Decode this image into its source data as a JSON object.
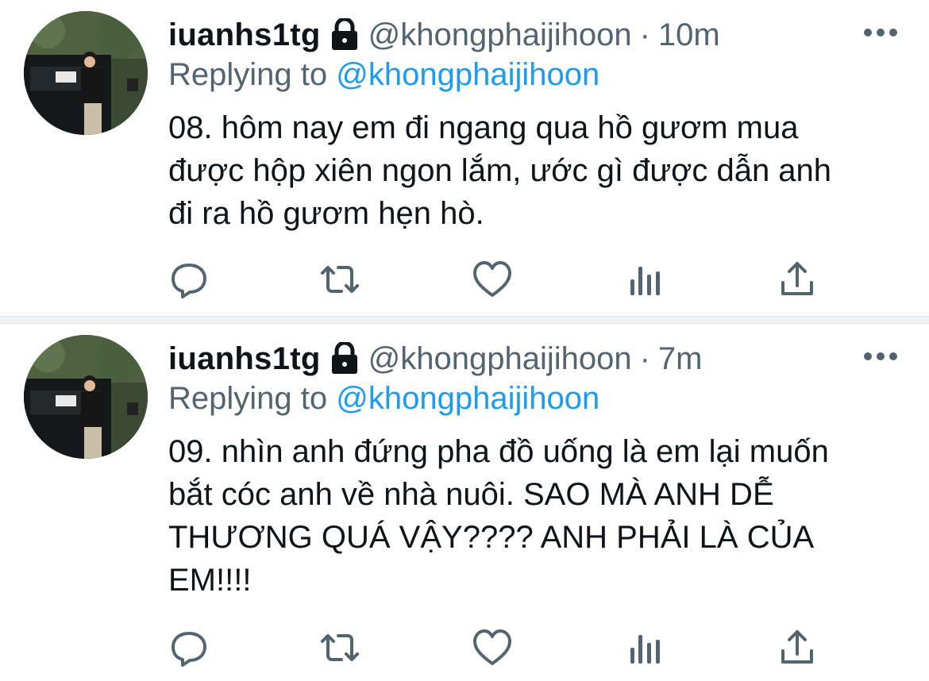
{
  "tweets": [
    {
      "display_name": "iuanhs1tg",
      "handle": "@khongphaijihoon",
      "separator": "·",
      "time": "10m",
      "replying_prefix": "Replying to",
      "replying_handle": "@khongphaijihoon",
      "text": "08. hôm nay em đi ngang qua hồ gươm mua\nđược hộp xiên ngon lắm, ước gì được dẫn anh\nđi ra hồ gươm hẹn hò.",
      "protected": true
    },
    {
      "display_name": "iuanhs1tg",
      "handle": "@khongphaijihoon",
      "separator": "·",
      "time": "7m",
      "replying_prefix": "Replying to",
      "replying_handle": "@khongphaijihoon",
      "text": "09. nhìn anh đứng pha đồ uống là em lại muốn\nbắt cóc anh về nhà nuôi. SAO MÀ ANH DỄ\nTHƯƠNG QUÁ VẬY???? ANH PHẢI LÀ CỦA\nEM!!!!",
      "protected": true
    }
  ],
  "icons": {
    "lock": "lock-icon",
    "more": "more-icon",
    "reply": "reply-icon",
    "retweet": "retweet-icon",
    "like": "heart-icon",
    "views": "analytics-icon",
    "share": "share-icon"
  },
  "colors": {
    "text": "#0f1419",
    "secondary": "#536471",
    "link": "#1d9bf0",
    "divider": "#eff3f4"
  }
}
